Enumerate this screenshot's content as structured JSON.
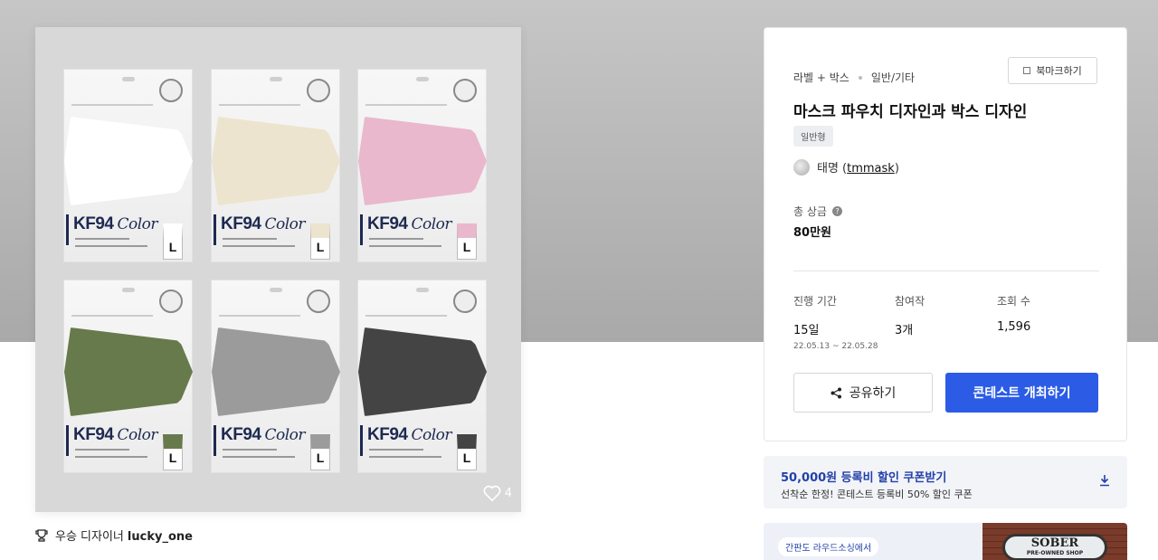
{
  "hero": {
    "pouches": [
      {
        "brand": "KF94",
        "script": "Color",
        "size": "L",
        "mask_color": "#ffffff"
      },
      {
        "brand": "KF94",
        "script": "Color",
        "size": "L",
        "mask_color": "#ece4cf"
      },
      {
        "brand": "KF94",
        "script": "Color",
        "size": "L",
        "mask_color": "#e9b8cd"
      },
      {
        "brand": "KF94",
        "script": "Color",
        "size": "L",
        "mask_color": "#677a4c"
      },
      {
        "brand": "KF94",
        "script": "Color",
        "size": "L",
        "mask_color": "#9b9b9b"
      },
      {
        "brand": "KF94",
        "script": "Color",
        "size": "L",
        "mask_color": "#444444"
      }
    ],
    "like_count": "4",
    "like_icon": "heart-icon"
  },
  "winner": {
    "icon": "trophy-icon",
    "label": "우승 디자이너",
    "name": "lucky_one"
  },
  "contest": {
    "category_main": "라벨 + 박스",
    "category_sub": "일반/기타",
    "bookmark_label": "북마크하기",
    "title": "마스크 파우치 디자인과 박스 디자인",
    "type_badge": "일반형",
    "host_name": "태명 (",
    "host_id": "tmmask",
    "host_close": ")",
    "prize_label": "총 상금",
    "prize_help": "?",
    "prize_value": "80만원",
    "stats": {
      "period_label": "진행 기간",
      "period_value": "15일",
      "period_range": "22.05.13 ~ 22.05.28",
      "entries_label": "참여작",
      "entries_value": "3개",
      "views_label": "조회 수",
      "views_value": "1,596"
    },
    "share_label": "공유하기",
    "host_button_label": "콘테스트 개최하기",
    "accent_color": "#2c5ce6"
  },
  "coupon": {
    "title": "50,000원 등록비 할인 쿠폰받기",
    "subtitle": "선착순 한정! 콘테스트 등록비 50% 할인 쿠폰",
    "icon": "download-icon"
  },
  "banner": {
    "pill": "간판도 라우드소싱에서",
    "sign_text": "SOBER",
    "sign_sub": "PRE-OWNED SHOP"
  }
}
